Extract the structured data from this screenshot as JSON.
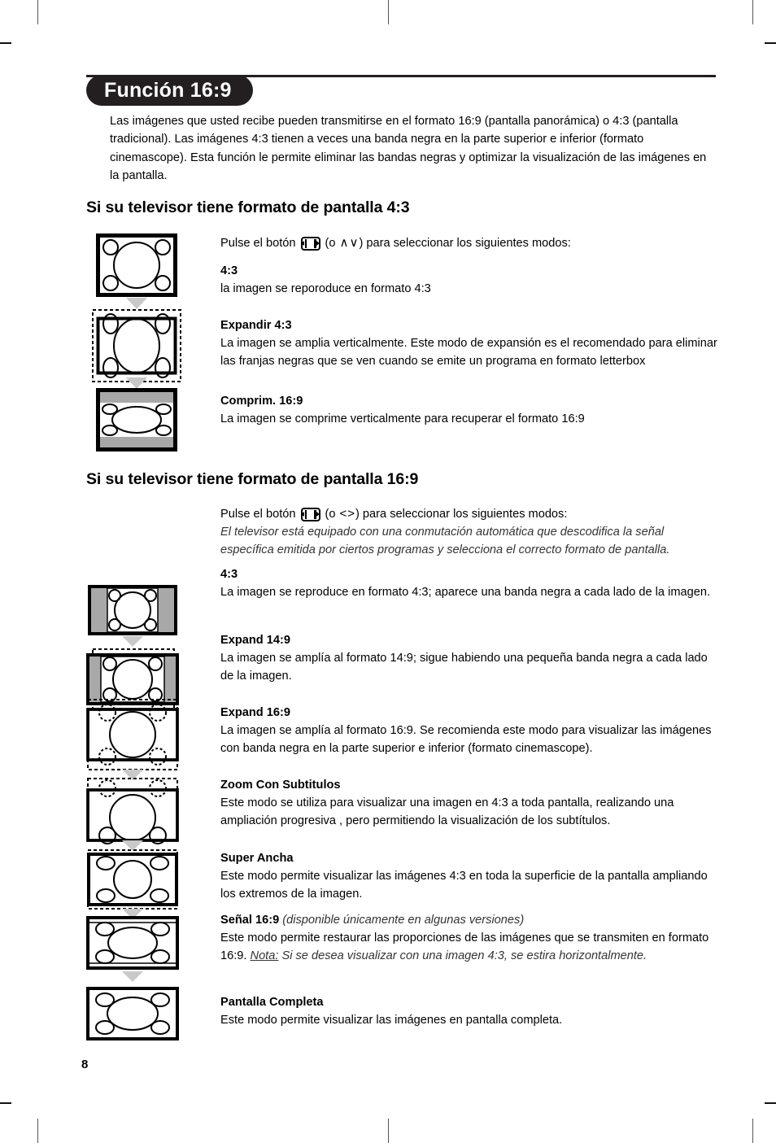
{
  "document": {
    "page_number": "8",
    "title": "Función 16:9",
    "intro": "Las imágenes que usted recibe pueden transmitirse en el formato 16:9 (pantalla panorámica) o 4:3 (pantalla tradicional). Las imágenes 4:3 tienen a veces una banda negra en la parte superior e inferior (formato cinemascope). Esta función le permite eliminar las bandas negras y optimizar la visualización de las imágenes en la pantalla."
  },
  "section_43": {
    "heading": "Si su televisor tiene formato de pantalla 4:3",
    "press_prefix": "Pulse el botón",
    "press_open": "(o",
    "press_keys": "∧∨",
    "press_suffix": ") para seleccionar los siguientes modos:",
    "modes": [
      {
        "label": "4:3",
        "text": "la imagen se reporoduce en formato 4:3"
      },
      {
        "label": "Expandir 4:3",
        "text": "La imagen se amplia verticalmente. Este modo de expansión es el recomendado para eliminar las franjas negras que se ven cuando se emite un programa en formato letterbox"
      },
      {
        "label": "Comprim. 16:9",
        "text": "La imagen se comprime verticalmente para recuperar el formato 16:9"
      }
    ]
  },
  "section_169": {
    "heading": "Si su televisor tiene formato de pantalla 16:9",
    "press_prefix": "Pulse el botón",
    "press_open": "(o",
    "press_keys": "<>",
    "press_suffix": ") para seleccionar los siguientes modos:",
    "auto_note": "El televisor está equipado con una conmutación automática que descodifica la señal específica emitida por ciertos programas y selecciona el correcto formato de pantalla.",
    "modes": [
      {
        "label": "4:3",
        "text": "La imagen se reproduce en formato 4:3; aparece una banda negra a cada lado de la imagen."
      },
      {
        "label": "Expand 14:9",
        "text": "La imagen se amplía al formato 14:9; sigue habiendo una pequeña banda negra a cada lado de la imagen."
      },
      {
        "label": "Expand 16:9",
        "text": "La imagen se amplía al formato 16:9. Se recomienda este modo para visualizar las imágenes con banda negra en la parte superior e inferior (formato cinemascope)."
      },
      {
        "label": "Zoom Con Subtitulos",
        "text": "Este modo se utiliza para visualizar una imagen en 4:3 a toda pantalla, realizando una ampliación progresiva , pero permitiendo la visualización de los subtítulos."
      },
      {
        "label": "Super Ancha",
        "text": "Este modo permite visualizar las imágenes 4:3 en toda la superficie de la pantalla ampliando los extremos de la imagen."
      },
      {
        "label": "Señal 16:9",
        "label_suffix": "(disponible únicamente en algunas versiones)",
        "text": "Este modo permite restaurar las proporciones de las imágenes que se transmiten en formato 16:9.",
        "note_label": "Nota:",
        "note_text": "Si se desea visualizar con una imagen 4:3, se estira horizontalmente."
      },
      {
        "label": "Pantalla Completa",
        "text": "Este modo permite visualizar las imágenes en pantalla completa."
      }
    ]
  },
  "colors": {
    "ink": "#231f20",
    "grayband": "#a8a8a8",
    "arrow": "#c9c9c9"
  },
  "diagrams": {
    "43": [
      {
        "name": "tv-43-normal"
      },
      {
        "name": "tv-43-expanded"
      },
      {
        "name": "tv-43-compressed"
      }
    ],
    "169": [
      {
        "name": "tv-169-43-sidebars"
      },
      {
        "name": "tv-169-expand-14-9"
      },
      {
        "name": "tv-169-expand-16-9"
      },
      {
        "name": "tv-169-zoom-subtitles"
      },
      {
        "name": "tv-169-super-wide"
      },
      {
        "name": "tv-169-signal-16-9"
      },
      {
        "name": "tv-169-full-screen"
      }
    ]
  }
}
